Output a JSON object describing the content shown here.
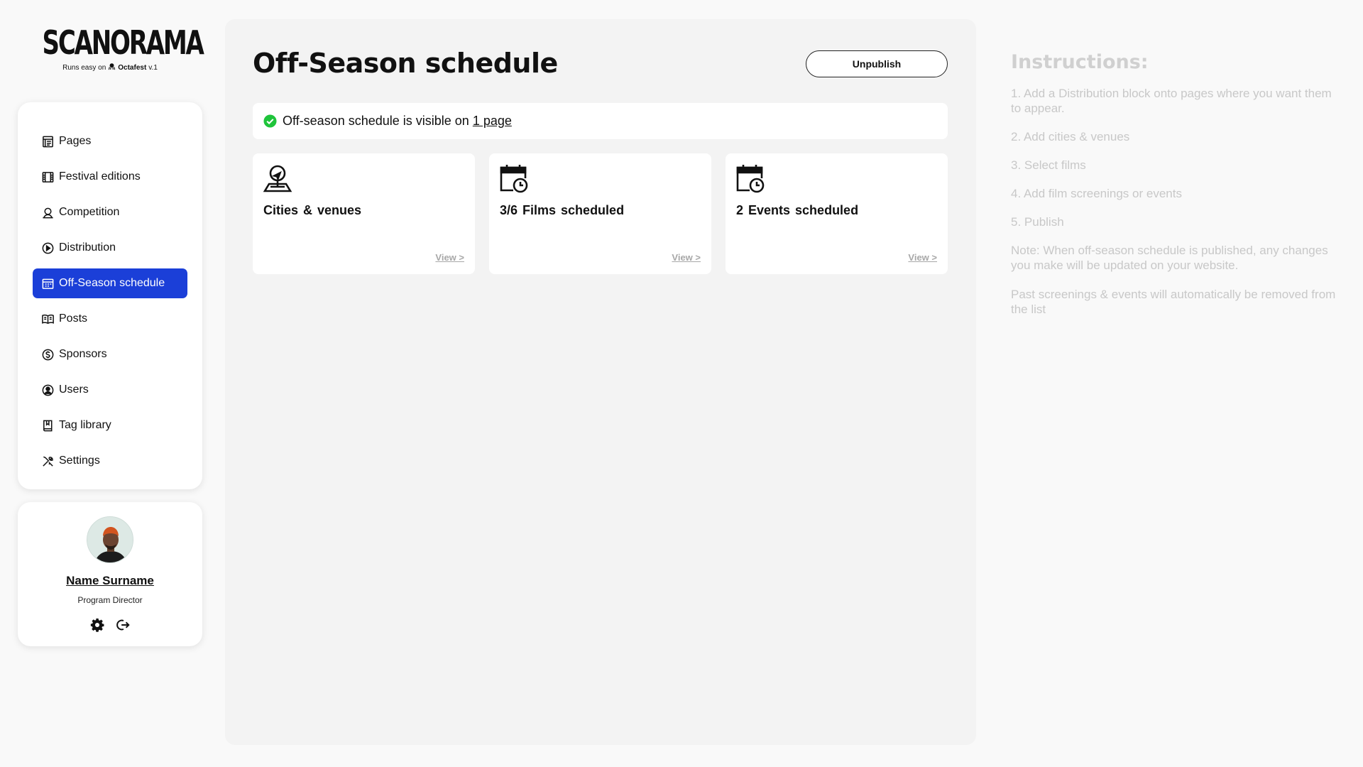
{
  "brand": {
    "name": "SCANORAMA",
    "tagline_prefix": "Runs easy on",
    "tagline_product": "Octafest",
    "tagline_version": "v.1"
  },
  "sidebar": {
    "items": [
      {
        "label": "Pages",
        "icon": "pages-icon",
        "active": false
      },
      {
        "label": "Festival editions",
        "icon": "film-icon",
        "active": false
      },
      {
        "label": "Competition",
        "icon": "award-icon",
        "active": false
      },
      {
        "label": "Distribution",
        "icon": "play-circle-icon",
        "active": false
      },
      {
        "label": "Off-Season schedule",
        "icon": "calendar-icon",
        "active": true
      },
      {
        "label": "Posts",
        "icon": "newspaper-icon",
        "active": false
      },
      {
        "label": "Sponsors",
        "icon": "dollar-circle-icon",
        "active": false
      },
      {
        "label": "Users",
        "icon": "user-circle-icon",
        "active": false
      },
      {
        "label": "Tag library",
        "icon": "book-icon",
        "active": false
      },
      {
        "label": "Settings",
        "icon": "tools-icon",
        "active": false
      }
    ]
  },
  "profile": {
    "name": "Name Surname",
    "role": "Program Director"
  },
  "main": {
    "title": "Off-Season schedule",
    "unpublish_label": "Unpublish",
    "status_text": "Off-season schedule is visible on",
    "status_link": "1 page",
    "cards": [
      {
        "title": "Cities & venues",
        "link": "View >",
        "icon": "map-pin-icon"
      },
      {
        "title": "3/6 Films scheduled",
        "link": "View >",
        "icon": "calendar-clock-icon"
      },
      {
        "title": "2 Events scheduled",
        "link": "View >",
        "icon": "calendar-clock-icon"
      }
    ]
  },
  "instructions": {
    "heading": "Instructions:",
    "steps": [
      "1. Add a Distribution block onto pages where you want them to appear.",
      "2. Add cities & venues",
      "3. Select films",
      "4. Add film screenings or events",
      "5. Publish"
    ],
    "note_line1": "Note: When off-season schedule is published, any changes",
    "note_line2": "you make will be updated on your website.",
    "past_note": "Past screenings & events will automatically be removed from the list"
  },
  "colors": {
    "accent": "#1b3fd8",
    "success": "#1fc43b",
    "muted_text": "#c8c8c8"
  }
}
